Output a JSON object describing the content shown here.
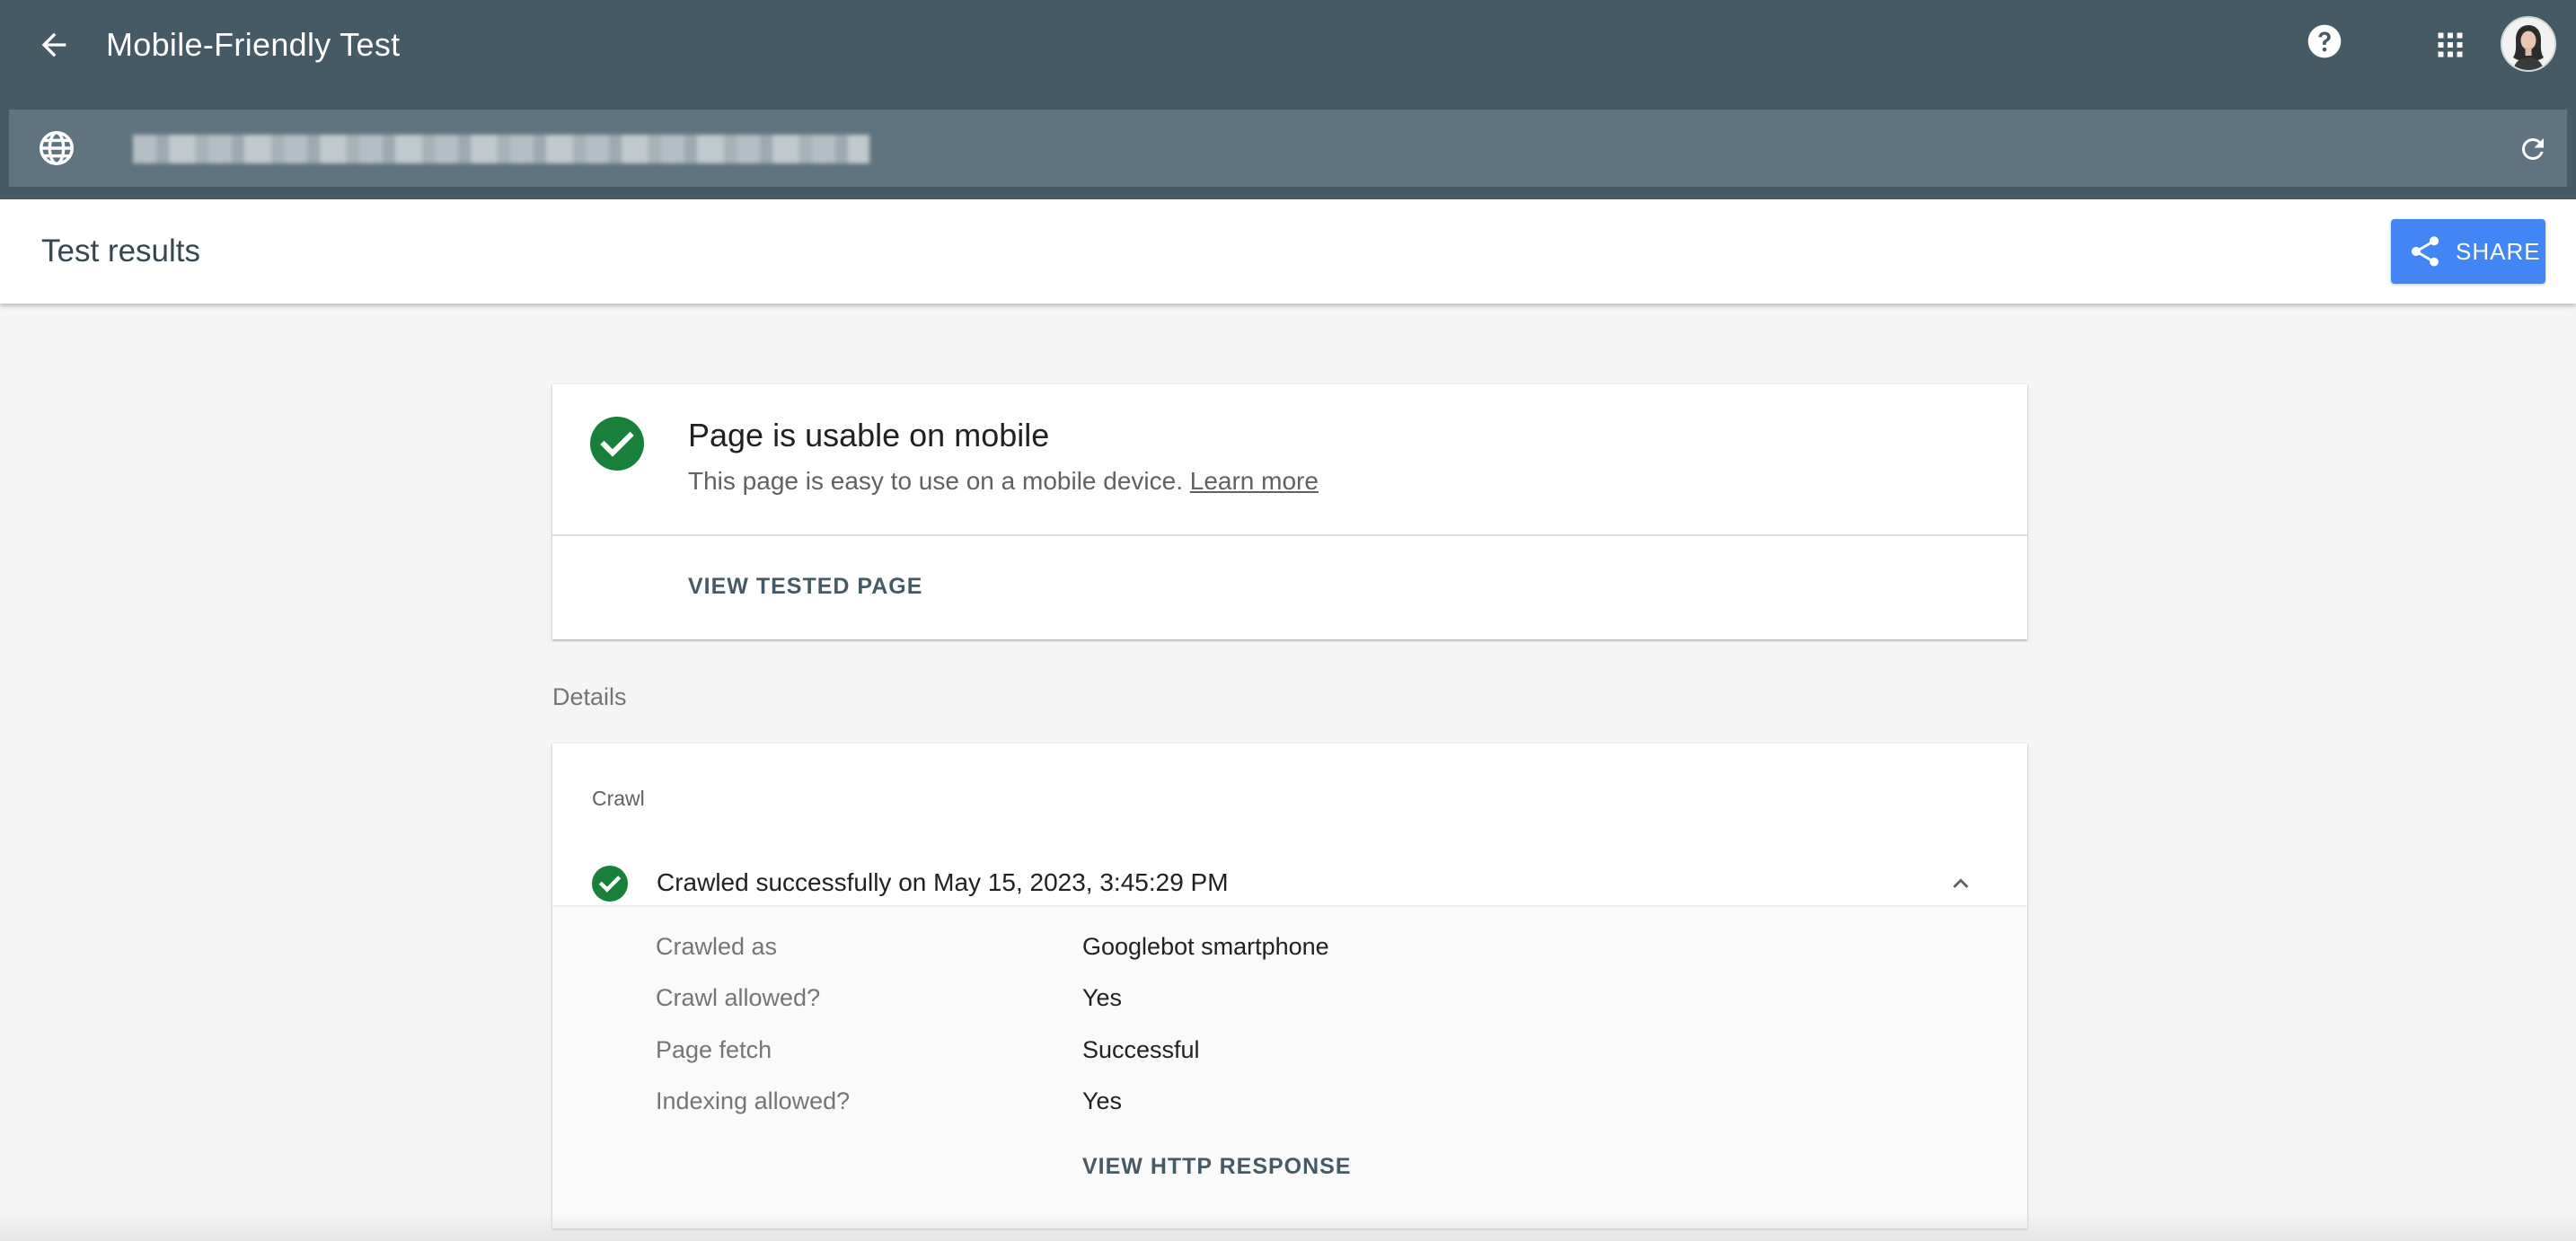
{
  "header": {
    "title": "Mobile-Friendly Test",
    "back_icon": "arrow-back-icon",
    "help_icon": "help-circle-icon",
    "apps_icon": "apps-grid-icon",
    "avatar_icon": "user-avatar"
  },
  "urlbar": {
    "url": "",
    "globe_icon": "globe-icon",
    "reload_icon": "refresh-icon"
  },
  "results": {
    "title": "Test results",
    "share_label": "SHARE",
    "share_icon": "share-icon"
  },
  "summary": {
    "title": "Page is usable on mobile",
    "description": "This page is easy to use on a mobile device.",
    "learn_more": "Learn more",
    "view_tested_page": "VIEW TESTED PAGE"
  },
  "details": {
    "label": "Details",
    "crawl": {
      "section_label": "Crawl",
      "status": "Crawled successfully on May 15, 2023, 3:45:29 PM",
      "rows": [
        {
          "key": "Crawled as",
          "value": "Googlebot smartphone"
        },
        {
          "key": "Crawl allowed?",
          "value": "Yes"
        },
        {
          "key": "Page fetch",
          "value": "Successful"
        },
        {
          "key": "Indexing allowed?",
          "value": "Yes"
        }
      ],
      "view_http_response": "VIEW HTTP RESPONSE"
    }
  },
  "colors": {
    "appbar": "#455a64",
    "urlbar": "#5f7480",
    "accent": "#4285f4",
    "success": "#188038"
  }
}
